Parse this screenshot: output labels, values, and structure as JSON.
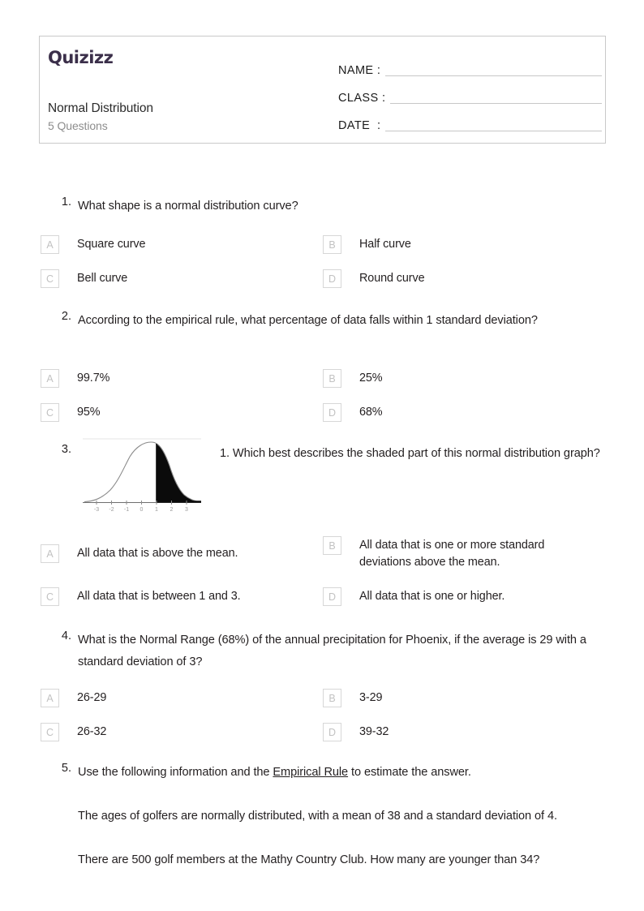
{
  "header": {
    "logo_text": "Quizizz",
    "quiz_title": "Normal Distribution",
    "question_count_label": "5 Questions",
    "fields": [
      {
        "label": "NAME :"
      },
      {
        "label": "CLASS :"
      },
      {
        "label": "DATE  :"
      }
    ]
  },
  "questions": [
    {
      "number": "1.",
      "text": "What shape is a normal distribution curve?",
      "options": [
        {
          "letter": "A",
          "text": "Square curve"
        },
        {
          "letter": "B",
          "text": "Half curve"
        },
        {
          "letter": "C",
          "text": "Bell curve"
        },
        {
          "letter": "D",
          "text": "Round curve"
        }
      ]
    },
    {
      "number": "2.",
      "text": "According to the empirical rule, what percentage of data falls within 1 standard deviation?",
      "options": [
        {
          "letter": "A",
          "text": "99.7%"
        },
        {
          "letter": "B",
          "text": "25%"
        },
        {
          "letter": "C",
          "text": "95%"
        },
        {
          "letter": "D",
          "text": "68%"
        }
      ]
    },
    {
      "number": "3.",
      "text": "1.  Which best describes the shaded part of this normal distribution graph?",
      "graph": {
        "alt": "normal distribution curve with region right of z = 1 shaded black",
        "x_ticks": [
          "-3",
          "-2",
          "-1",
          "0",
          "1",
          "2",
          "3"
        ],
        "shade_from": 1
      },
      "options": [
        {
          "letter": "A",
          "text": "All data that is above the mean."
        },
        {
          "letter": "B",
          "text": "All data that is one or more standard deviations above the mean."
        },
        {
          "letter": "C",
          "text": "All data that is between 1 and 3."
        },
        {
          "letter": "D",
          "text": "All data that is one or higher."
        }
      ]
    },
    {
      "number": "4.",
      "text": "What is the Normal Range (68%) of the annual precipitation for Phoenix, if the average is 29 with a standard deviation of 3?",
      "options": [
        {
          "letter": "A",
          "text": "26-29"
        },
        {
          "letter": "B",
          "text": "3-29"
        },
        {
          "letter": "C",
          "text": "26-32"
        },
        {
          "letter": "D",
          "text": "39-32"
        }
      ]
    },
    {
      "number": "5.",
      "paragraphs": {
        "p1_before": "Use the following information and the ",
        "p1_underlined": "Empirical Rule",
        "p1_after": " to estimate the answer.",
        "p2": "The ages of golfers are normally distributed, with a mean of 38 and a standard deviation of 4.",
        "p3": "There are 500 golf members at the Mathy Country Club. How many are younger than 34?"
      }
    }
  ],
  "colors": {
    "logo": "#3b2f4a",
    "text": "#231f20",
    "muted": "#8d8d8d",
    "border": "#c9c9c9",
    "option_border": "#d7d7d7",
    "option_letter": "#c2c2c2"
  }
}
